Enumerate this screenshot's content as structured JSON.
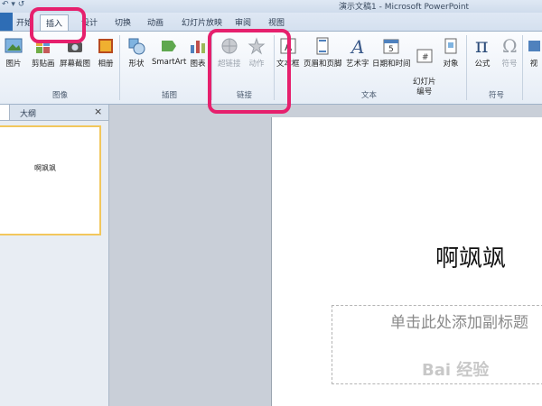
{
  "window": {
    "title": "演示文稿1 - Microsoft PowerPoint",
    "quick_access": "↶ ▾ ↺"
  },
  "tabs": {
    "file_label": "",
    "home": "开始",
    "insert": "插入",
    "design": "设计",
    "transitions": "切换",
    "animations": "动画",
    "slideshow": "幻灯片放映",
    "review": "审阅",
    "view": "视图"
  },
  "ribbon": {
    "images": {
      "group": "图像",
      "picture": "图片",
      "clipart": "剪贴画",
      "screenshot": "屏幕截图",
      "album": "相册"
    },
    "illustrations": {
      "group": "插图",
      "shapes": "形状",
      "smartart": "SmartArt",
      "chart": "图表"
    },
    "links": {
      "group": "链接",
      "hyperlink": "超链接",
      "action": "动作"
    },
    "text": {
      "group": "文本",
      "textbox": "文本框",
      "headerfooter": "页眉和页脚",
      "wordart": "艺术字",
      "datetime": "日期和时间",
      "slidenum": "幻灯片\n编号",
      "object": "对象"
    },
    "symbols": {
      "group": "符号",
      "equation": "公式",
      "symbol": "符号",
      "video_label": "视"
    }
  },
  "left_pane": {
    "outline_tab": "大纲",
    "close": "×",
    "thumb_title": "啊飒飒"
  },
  "slide": {
    "title": "啊飒飒",
    "subtitle_placeholder": "单击此处添加副标题"
  },
  "watermark": "Bai 经验",
  "colors": {
    "highlight": "#e6206d",
    "file_tab": "#2e6db5"
  }
}
